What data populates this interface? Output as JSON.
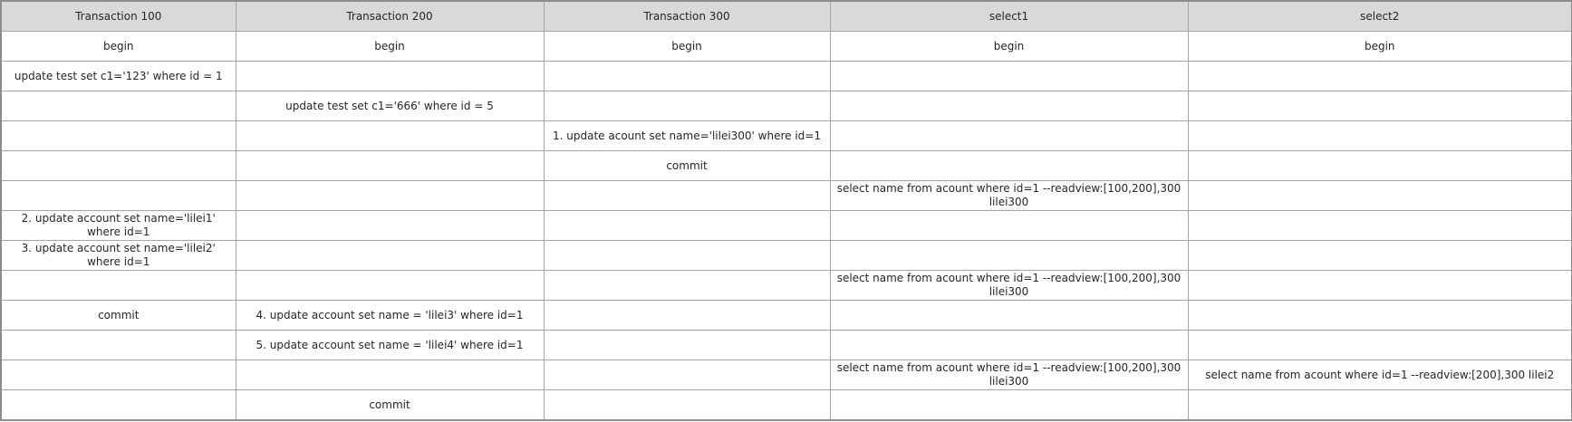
{
  "headers": [
    "Transaction 100",
    "Transaction 200",
    "Transaction 300",
    "select1",
    "select2"
  ],
  "rows": [
    [
      "begin",
      "begin",
      "begin",
      "begin",
      "begin"
    ],
    [
      "update test set c1='123' where id = 1",
      "",
      "",
      "",
      ""
    ],
    [
      "",
      "update test set c1='666' where id = 5",
      "",
      "",
      ""
    ],
    [
      "",
      "",
      "1. update acount set name='lilei300' where id=1",
      "",
      ""
    ],
    [
      "",
      "",
      "commit",
      "",
      ""
    ],
    [
      "",
      "",
      "",
      "select name from acount  where id=1 --readview:[100,200],300   lilei300",
      ""
    ],
    [
      "2. update account set name='lilei1' where id=1",
      "",
      "",
      "",
      ""
    ],
    [
      "3. update account set name='lilei2' where id=1",
      "",
      "",
      "",
      ""
    ],
    [
      "",
      "",
      "",
      "select name from acount  where id=1  --readview:[100,200],300   lilei300",
      ""
    ],
    [
      "commit",
      "4. update account set name = 'lilei3' where id=1",
      "",
      "",
      ""
    ],
    [
      "",
      "5. update account set name = 'lilei4' where id=1",
      "",
      "",
      ""
    ],
    [
      "",
      "",
      "",
      "select name from acount  where id=1  --readview:[100,200],300   lilei300",
      "select name from acount  where id=1  --readview:[200],300   lilei2"
    ],
    [
      "",
      "commit",
      "",
      "",
      ""
    ]
  ]
}
